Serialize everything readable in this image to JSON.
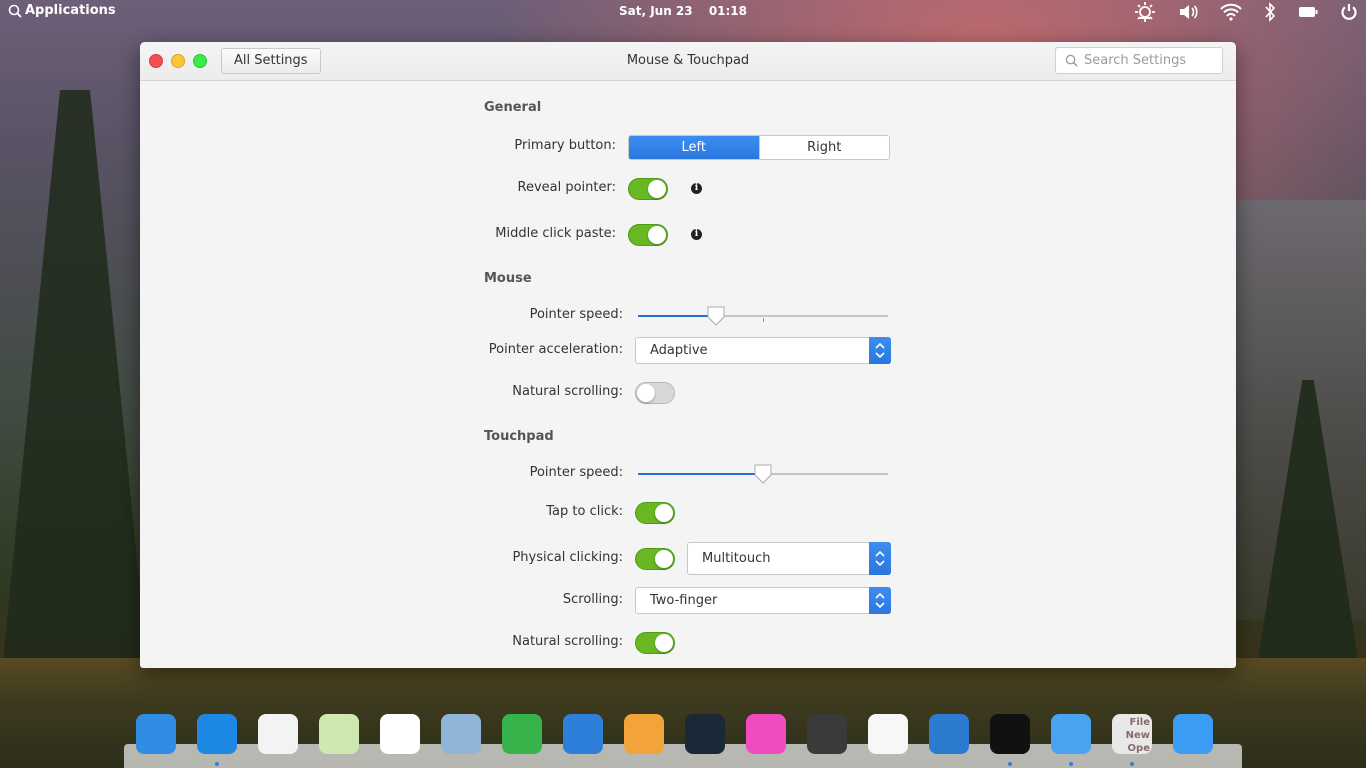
{
  "top_panel": {
    "applications_label": "Applications",
    "date": "Sat, Jun 23",
    "time": "01:18",
    "indicators": [
      "brightness-icon",
      "volume-icon",
      "wifi-icon",
      "bluetooth-icon",
      "battery-icon",
      "power-icon"
    ]
  },
  "window": {
    "title": "Mouse & Touchpad",
    "all_settings_label": "All Settings",
    "search_placeholder": "Search Settings"
  },
  "general": {
    "heading": "General",
    "primary_button_label": "Primary button:",
    "primary_options": [
      "Left",
      "Right"
    ],
    "primary_selected": "Left",
    "reveal_pointer_label": "Reveal pointer:",
    "reveal_pointer_on": true,
    "middle_click_label": "Middle click paste:",
    "middle_click_on": true
  },
  "mouse": {
    "heading": "Mouse",
    "pointer_speed_label": "Pointer speed:",
    "pointer_speed": 0.31,
    "pointer_accel_label": "Pointer acceleration:",
    "pointer_accel_value": "Adaptive",
    "natural_scrolling_label": "Natural scrolling:",
    "natural_scrolling_on": false
  },
  "touchpad": {
    "heading": "Touchpad",
    "pointer_speed_label": "Pointer speed:",
    "pointer_speed": 0.5,
    "tap_label": "Tap to click:",
    "tap_on": true,
    "physical_label": "Physical clicking:",
    "physical_on": true,
    "physical_mode": "Multitouch",
    "scrolling_label": "Scrolling:",
    "scrolling_value": "Two-finger",
    "natural_scrolling_label": "Natural scrolling:",
    "natural_scrolling_on": true
  },
  "dock": {
    "items": [
      {
        "name": "multitasking-view-icon",
        "color": "#2f8de4",
        "running": false
      },
      {
        "name": "safari-icon",
        "color": "#1e88e5",
        "running": true
      },
      {
        "name": "calendar-icon",
        "color": "#f3f3f3",
        "running": false
      },
      {
        "name": "maps-icon",
        "color": "#cfe8b0",
        "running": false
      },
      {
        "name": "reminders-icon",
        "color": "#ffffff",
        "running": false
      },
      {
        "name": "photos-icon",
        "color": "#8fb6d8",
        "running": false
      },
      {
        "name": "numbers-icon",
        "color": "#36b34a",
        "running": false
      },
      {
        "name": "keynote-icon",
        "color": "#2d7fd9",
        "running": false
      },
      {
        "name": "pages-icon",
        "color": "#f2a33a",
        "running": false
      },
      {
        "name": "steam-icon",
        "color": "#1b2838",
        "running": false
      },
      {
        "name": "itunes-icon",
        "color": "#f04cc0",
        "running": false
      },
      {
        "name": "final-cut-icon",
        "color": "#3a3a3a",
        "running": false
      },
      {
        "name": "task-list-icon",
        "color": "#f7f7f7",
        "running": false
      },
      {
        "name": "vscode-icon",
        "color": "#2b7bd0",
        "running": false
      },
      {
        "name": "terminal-icon",
        "color": "#111111",
        "running": true
      },
      {
        "name": "finder-icon",
        "color": "#4aa3f0",
        "running": true
      },
      {
        "name": "file-manager-icon",
        "color": "#e8e8e8",
        "running": true,
        "text": [
          "File",
          "New",
          "Ope"
        ]
      },
      {
        "name": "desktop-icon",
        "color": "#3a9cf2",
        "running": false
      }
    ]
  },
  "colors": {
    "accent": "#2a76df",
    "switch_on": "#68b723",
    "window_bg": "#f4f4f4"
  }
}
